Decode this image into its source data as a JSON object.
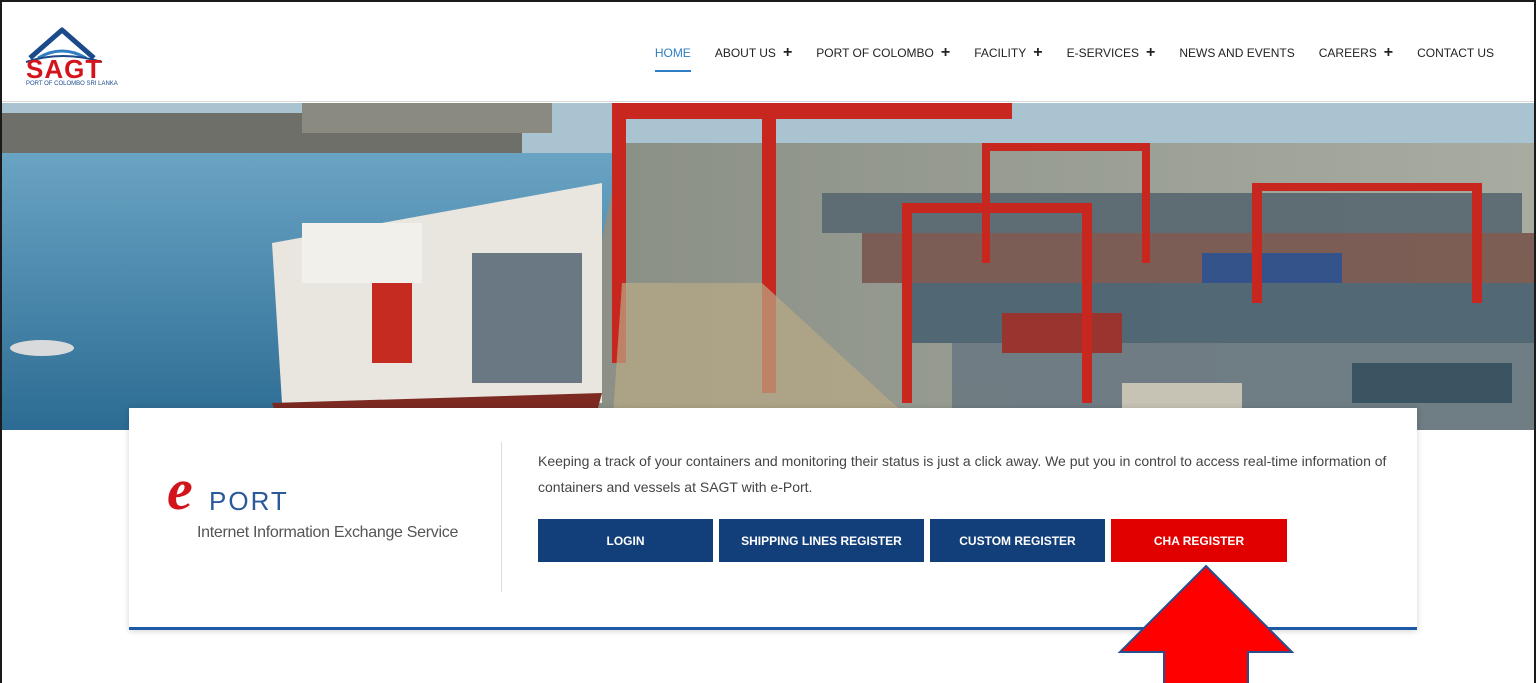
{
  "logo": {
    "text": "SAGT",
    "subtitle": "PORT OF COLOMBO SRI LANKA"
  },
  "nav": {
    "items": [
      {
        "label": "HOME",
        "active": true,
        "plus": false
      },
      {
        "label": "ABOUT US",
        "active": false,
        "plus": true
      },
      {
        "label": "PORT OF COLOMBO",
        "active": false,
        "plus": true
      },
      {
        "label": "FACILITY",
        "active": false,
        "plus": true
      },
      {
        "label": "E-SERVICES",
        "active": false,
        "plus": true
      },
      {
        "label": "NEWS AND EVENTS",
        "active": false,
        "plus": false
      },
      {
        "label": "CAREERS",
        "active": false,
        "plus": true
      },
      {
        "label": "CONTACT US",
        "active": false,
        "plus": false
      }
    ],
    "plus_symbol": "+"
  },
  "eport": {
    "letter": "e",
    "word": "PORT",
    "tagline": "Internet Information Exchange Service"
  },
  "description": "Keeping a track of your containers and monitoring their status is just a click away. We put you in control to access real-time information of containers and vessels at SAGT with e-Port.",
  "buttons": {
    "login": "LOGIN",
    "shipping_lines_register": "SHIPPING LINES REGISTER",
    "custom_register": "CUSTOM REGISTER",
    "cha_register": "CHA REGISTER"
  },
  "colors": {
    "brand_red": "#d3141c",
    "brand_blue": "#123f7a",
    "active_nav": "#2f7ec4",
    "highlight_button": "#e00000",
    "annotation_arrow": "#ff0000"
  },
  "annotation": {
    "icon": "up-arrow-icon",
    "target": "CHA REGISTER"
  }
}
